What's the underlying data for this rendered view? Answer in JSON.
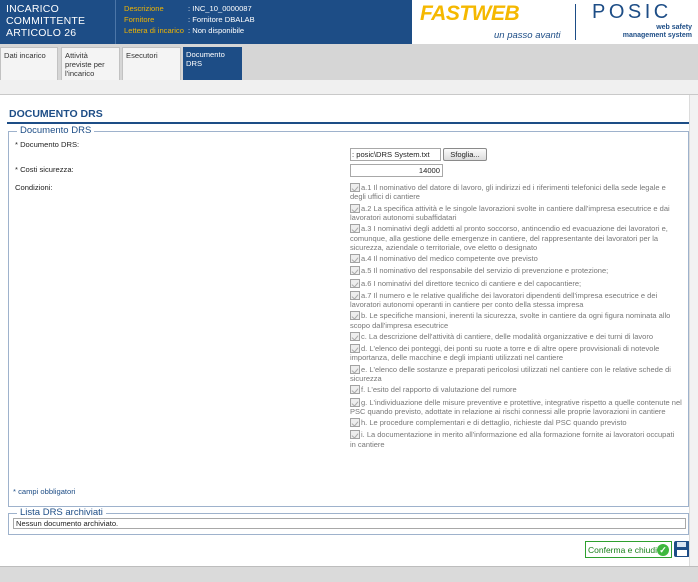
{
  "header": {
    "title": [
      "INCARICO",
      "COMMITTENTE",
      "ARTICOLO 26"
    ],
    "info": [
      {
        "label": "Descrizione",
        "value": ": INC_10_0000087"
      },
      {
        "label": "Fornitore",
        "value": ": Fornitore DBALAB"
      },
      {
        "label": "Lettera di incarico",
        "value": ": Non disponibile"
      }
    ],
    "fastweb_logo": "FASTWEB",
    "fastweb_slogan": "un passo avanti",
    "posic_logo": "POSIC",
    "posic_sub": [
      "web safety",
      "management system"
    ]
  },
  "tabs": [
    {
      "label": "Dati incarico",
      "active": false
    },
    {
      "label": "Attività previste per l'incarico",
      "active": false
    },
    {
      "label": "Esecutori",
      "active": false
    },
    {
      "label": "Documento DRS",
      "active": true
    }
  ],
  "page": {
    "title": "DOCUMENTO DRS",
    "fieldset_drs_legend": "Documento DRS",
    "documento_label": "* Documento DRS:",
    "file_value": ": posic\\DRS System.txt",
    "browse_label": "Sfoglia...",
    "costi_label": "* Costi sicurezza:",
    "costi_value": "14000",
    "condizioni_label": "Condizioni:",
    "conditions": [
      "a.1 Il nominativo del datore di lavoro, gli indirizzi ed i riferimenti telefonici della sede legale e degli uffici di cantiere",
      "a.2 La specifica attività e le singole lavorazioni svolte in cantiere dall'impresa esecutrice e dai lavoratori autonomi subaffidatari",
      "a.3 I nominativi degli addetti al pronto soccorso, antincendio ed evacuazione dei lavoratori e, comunque, alla gestione delle emergenze in cantiere, del rappresentante dei lavoratori per la sicurezza, aziendale o territoriale, ove eletto o designato",
      "a.4 Il nominativo del medico competente ove previsto",
      "a.5 Il nominativo del responsabile del servizio di prevenzione e protezione;",
      "a.6 I nominativi del direttore tecnico di cantiere e del capocantiere;",
      "a.7 Il numero e le relative qualifiche dei lavoratori dipendenti dell'impresa esecutrice e dei lavoratori autonomi operanti in cantiere per conto della stessa impresa",
      "b. Le specifiche mansioni, inerenti la sicurezza, svolte in cantiere da ogni figura nominata allo scopo dall'impresa esecutrice",
      "c. La descrizione dell'attività di cantiere, delle modalità organizzative e dei turni di lavoro",
      "d. L'elenco dei ponteggi, dei ponti su ruote a torre e di altre opere provvisionali di notevole importanza, delle macchine e degli impianti utilizzati nel cantiere",
      "e. L'elenco delle sostanze e preparati pericolosi utilizzati nel cantiere con le relative schede di sicurezza",
      "f. L'esito del rapporto di valutazione del rumore",
      "g. L'individuazione delle misure preventive e protettive, integrative rispetto a quelle contenute nel PSC quando previsto, adottate in relazione ai rischi connessi alle proprie lavorazioni in cantiere",
      "h. Le procedure complementari e di dettaglio, richieste dal PSC quando previsto",
      "i. La documentazione in merito all'informazione ed alla formazione fornite ai lavoratori occupati in cantiere"
    ],
    "required_note": "* campi obbligatori",
    "fieldset_lista_legend": "Lista DRS archiviati",
    "lista_text": "Nessun documento archiviato.",
    "confirm_label": "Conferma e chiudi"
  },
  "colors": {
    "brand_blue": "#1d4d86",
    "fastweb_yellow": "#f5b800",
    "confirm_green": "#3eb83e"
  }
}
